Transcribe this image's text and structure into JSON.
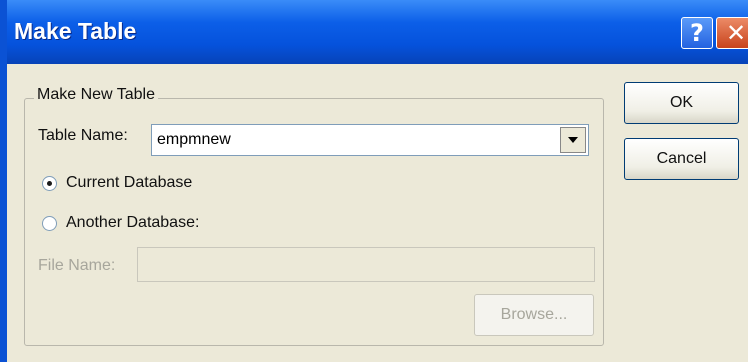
{
  "window": {
    "title": "Make Table",
    "help_glyph": "?",
    "close_glyph": "✕",
    "titlebar_color": "#0552dc"
  },
  "group": {
    "legend": "Make New Table",
    "table_name_label": "Table Name:",
    "table_name_value": "empmnew",
    "radio_current_label": "Current Database",
    "radio_another_label": "Another Database:",
    "selected_option": "Current Database",
    "file_name_label": "File Name:",
    "file_name_value": "",
    "browse_label": "Browse..."
  },
  "buttons": {
    "ok_label": "OK",
    "cancel_label": "Cancel"
  }
}
